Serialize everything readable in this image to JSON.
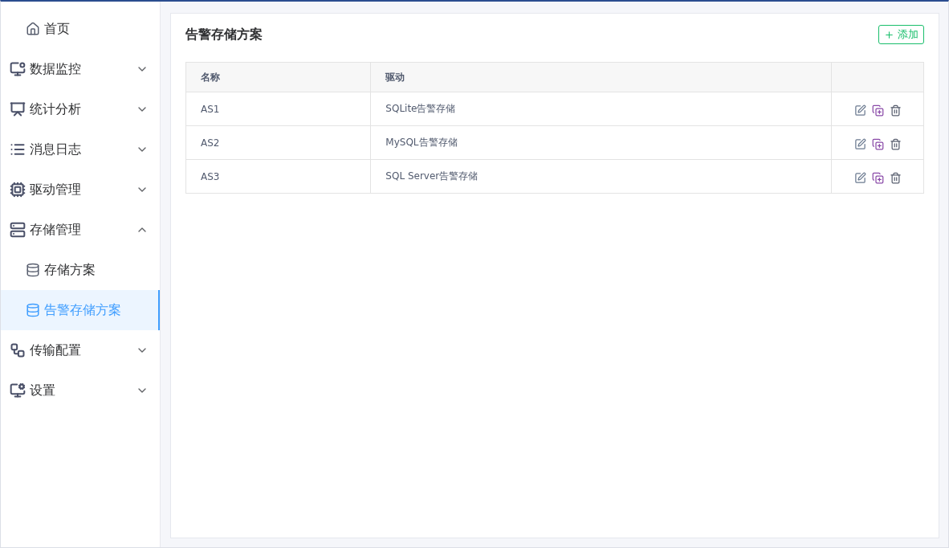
{
  "sidebar": {
    "items": [
      {
        "kind": "link",
        "label": "首页",
        "selected": false
      },
      {
        "kind": "group",
        "label": "数据监控",
        "expanded": false
      },
      {
        "kind": "group",
        "label": "统计分析",
        "expanded": false
      },
      {
        "kind": "group",
        "label": "消息日志",
        "expanded": false
      },
      {
        "kind": "group",
        "label": "驱动管理",
        "expanded": false
      },
      {
        "kind": "group",
        "label": "存储管理",
        "expanded": true,
        "children": [
          {
            "label": "存储方案",
            "selected": false
          },
          {
            "label": "告警存储方案",
            "selected": true
          }
        ]
      },
      {
        "kind": "group",
        "label": "传输配置",
        "expanded": false
      },
      {
        "kind": "group",
        "label": "设置",
        "expanded": false
      }
    ]
  },
  "content": {
    "title": "告警存储方案",
    "add_button": "添加",
    "table": {
      "columns": [
        "名称",
        "驱动"
      ],
      "rows": [
        {
          "cells": [
            "AS1",
            "SQLite告警存储"
          ]
        },
        {
          "cells": [
            "AS2",
            "MySQL告警存储"
          ]
        },
        {
          "cells": [
            "AS3",
            "SQL Server告警存储"
          ]
        }
      ]
    }
  }
}
